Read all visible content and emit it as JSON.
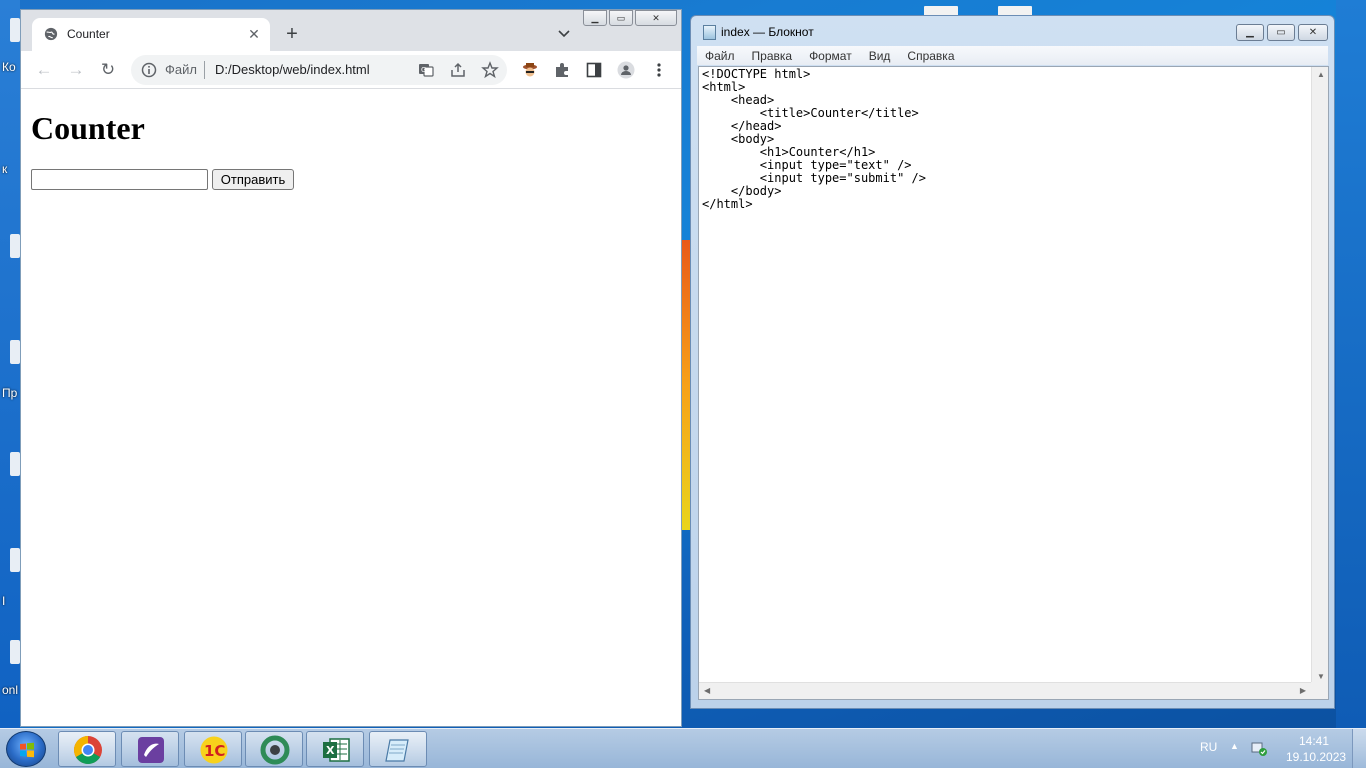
{
  "desktop": {
    "labels": [
      "Ко",
      "к",
      "Пр",
      "I",
      "onl"
    ]
  },
  "chrome": {
    "tab_title": "Counter",
    "omnibox": {
      "scheme_label": "Файл",
      "url": "D:/Desktop/web/index.html"
    },
    "page": {
      "heading": "Counter",
      "text_input_value": "",
      "submit_label": "Отправить"
    }
  },
  "notepad": {
    "title": "index — Блокнот",
    "menu": [
      "Файл",
      "Правка",
      "Формат",
      "Вид",
      "Справка"
    ],
    "content": "<!DOCTYPE html>\n<html>\n    <head>\n        <title>Counter</title>\n    </head>\n    <body>\n        <h1>Counter</h1>\n        <input type=\"text\" />\n        <input type=\"submit\" />\n    </body>\n</html>"
  },
  "taskbar": {
    "apps": [
      "chrome-icon",
      "viber-like-icon",
      "1c-icon",
      "recycle-app-icon",
      "excel-icon",
      "notepad-icon"
    ],
    "tray": {
      "language": "RU",
      "time": "14:41",
      "date": "19.10.2023"
    }
  },
  "colors": {
    "chrome_frame": "#dee1e6",
    "desktop_blue": "#1583d8",
    "taskbar": "#a7c0de"
  }
}
